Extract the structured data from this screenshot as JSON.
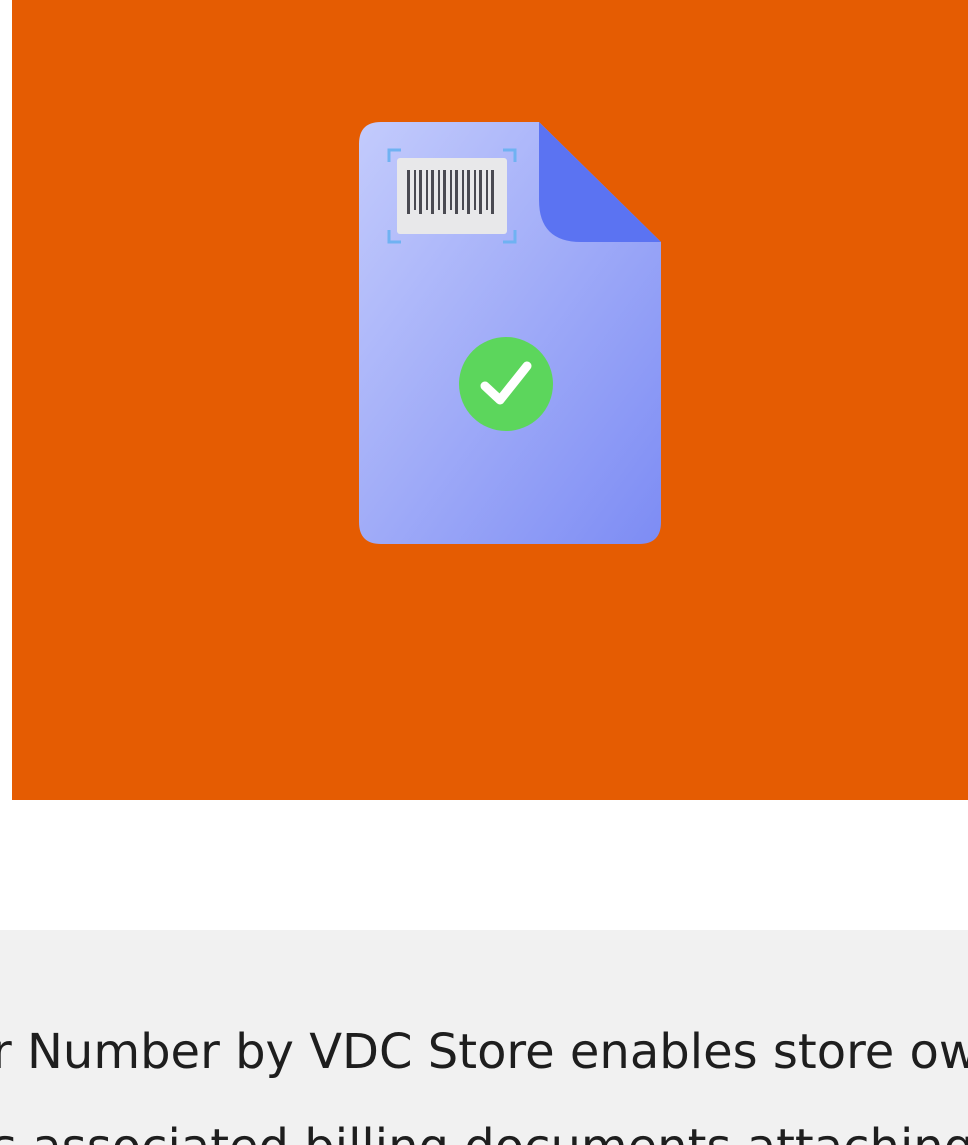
{
  "hero": {
    "background_color": "#e55c02",
    "illustration": {
      "icon": "document-barcode-check-icon",
      "document_color_light": "#b9c2fb",
      "document_color_dark": "#7f8ff5",
      "fold_color": "#5b73f2",
      "check_color": "#5cd65c"
    }
  },
  "description": {
    "background_color": "#f1f1f1",
    "line_1": "r Number by VDC Store enables store owne",
    "line_2": "s associated billing documents attaching Ord"
  }
}
